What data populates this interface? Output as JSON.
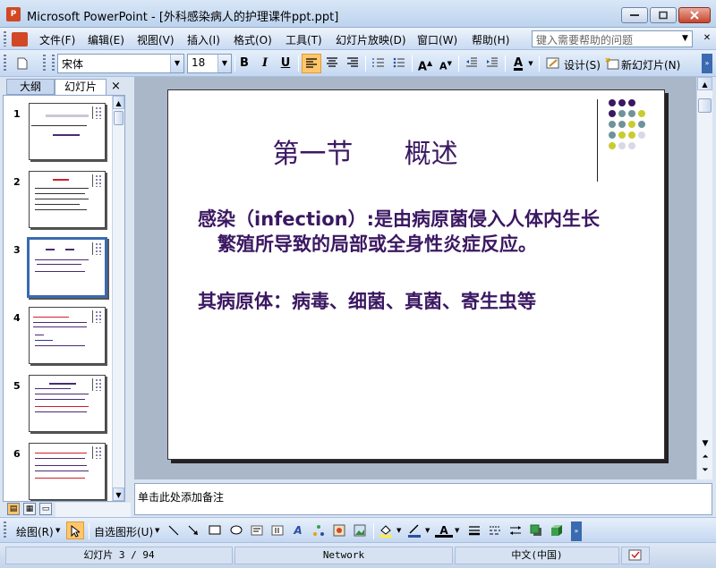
{
  "window": {
    "title": "Microsoft PowerPoint - [外科感染病人的护理课件ppt.ppt]",
    "app_icon_text": "P"
  },
  "menu": {
    "items": [
      "文件(F)",
      "编辑(E)",
      "视图(V)",
      "插入(I)",
      "格式(O)",
      "工具(T)",
      "幻灯片放映(D)",
      "窗口(W)",
      "帮助(H)"
    ],
    "help_placeholder": "键入需要帮助的问题"
  },
  "format_toolbar": {
    "font_name": "宋体",
    "font_size": "18",
    "bold": "B",
    "italic": "I",
    "underline": "U",
    "design_label": "设计(S)",
    "new_slide_label": "新幻灯片(N)"
  },
  "panel": {
    "tab_outline": "大纲",
    "tab_slides": "幻灯片",
    "close": "×",
    "slides": [
      {
        "number": "1"
      },
      {
        "number": "2"
      },
      {
        "number": "3"
      },
      {
        "number": "4"
      },
      {
        "number": "5"
      },
      {
        "number": "6"
      }
    ],
    "selected_index": 3
  },
  "slide": {
    "title": "第一节      概述",
    "body_line1": "感染（infection）:是由病原菌侵入人体内生长",
    "body_line2": "繁殖所导致的局部或全身性炎症反应。",
    "body_para2": "其病原体：病毒、细菌、真菌、寄生虫等",
    "colors": {
      "title": "#3b1862",
      "dot_purple": "#3b1862",
      "dot_teal": "#6e939a",
      "dot_yellow": "#c9cc2e",
      "dot_gray": "#d8d8e6"
    }
  },
  "notes": {
    "placeholder": "单击此处添加备注"
  },
  "draw_toolbar": {
    "draw_label": "绘图(R)",
    "autoshapes_label": "自选图形(U)"
  },
  "status": {
    "slide_info": "幻灯片 3 / 94",
    "design": "Network",
    "language": "中文(中国)"
  }
}
